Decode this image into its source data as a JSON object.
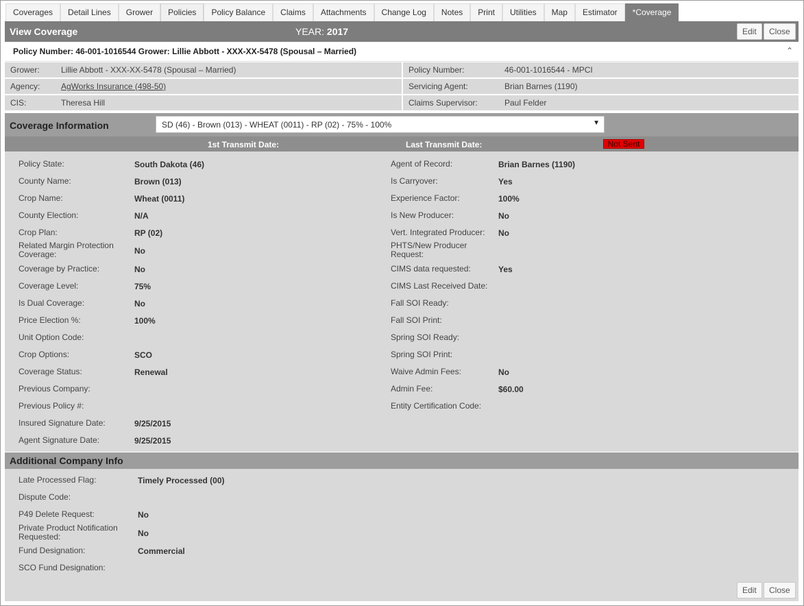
{
  "tabs": [
    {
      "label": "Coverages"
    },
    {
      "label": "Detail Lines"
    },
    {
      "label": "Grower"
    },
    {
      "label": "Policies"
    },
    {
      "label": "Policy Balance"
    },
    {
      "label": "Claims"
    },
    {
      "label": "Attachments"
    },
    {
      "label": "Change Log"
    },
    {
      "label": "Notes"
    },
    {
      "label": "Print"
    },
    {
      "label": "Utilities"
    },
    {
      "label": "Map"
    },
    {
      "label": "Estimator"
    },
    {
      "label": "*Coverage"
    }
  ],
  "header": {
    "title": "View Coverage",
    "year_label": "YEAR:",
    "year_value": "2017",
    "edit_label": "Edit",
    "close_label": "Close"
  },
  "summary": {
    "text": "Policy Number: 46-001-1016544 Grower: Lillie Abbott - XXX-XX-5478 (Spousal – Married)",
    "caret": "^"
  },
  "info": {
    "grower_label": "Grower:",
    "grower_value": "Lillie Abbott - XXX-XX-5478 (Spousal – Married)",
    "policy_number_label": "Policy Number:",
    "policy_number_value": "46-001-1016544 - MPCI",
    "agency_label": "Agency:",
    "agency_value": "AgWorks Insurance (498-50)",
    "servicing_agent_label": "Servicing Agent:",
    "servicing_agent_value": "Brian Barnes (1190)",
    "cis_label": "CIS:",
    "cis_value": "Theresa Hill",
    "claims_supervisor_label": "Claims Supervisor:",
    "claims_supervisor_value": "Paul Felder"
  },
  "coverage_section": {
    "title": "Coverage Information",
    "selected": "SD (46) - Brown (013) - WHEAT (0011) - RP (02) - 75% - 100%",
    "arrow": "▼",
    "first_transmit_label": "1st Transmit Date:",
    "last_transmit_label": "Last Transmit Date:",
    "status_badge": "Not Sent"
  },
  "left_fields": [
    {
      "label": "Policy State:",
      "value": "South Dakota (46)"
    },
    {
      "label": "County Name:",
      "value": "Brown (013)"
    },
    {
      "label": "Crop Name:",
      "value": "Wheat (0011)"
    },
    {
      "label": "County Election:",
      "value": "N/A"
    },
    {
      "label": "Crop Plan:",
      "value": "RP (02)"
    },
    {
      "label": "Related Margin Protection Coverage:",
      "value": "No"
    },
    {
      "label": "Coverage by Practice:",
      "value": "No"
    },
    {
      "label": "Coverage Level:",
      "value": "75%"
    },
    {
      "label": "Is Dual Coverage:",
      "value": "No"
    },
    {
      "label": "Price Election %:",
      "value": "100%"
    },
    {
      "label": "Unit Option Code:",
      "value": ""
    },
    {
      "label": "Crop Options:",
      "value": "SCO"
    },
    {
      "label": "Coverage Status:",
      "value": "Renewal"
    },
    {
      "label": "Previous Company:",
      "value": ""
    },
    {
      "label": "Previous Policy #:",
      "value": ""
    },
    {
      "label": "Insured Signature Date:",
      "value": "9/25/2015"
    },
    {
      "label": "Agent Signature Date:",
      "value": "9/25/2015"
    }
  ],
  "right_fields": [
    {
      "label": "Agent of Record:",
      "value": "Brian Barnes (1190)"
    },
    {
      "label": "Is Carryover:",
      "value": "Yes"
    },
    {
      "label": "Experience Factor:",
      "value": "100%"
    },
    {
      "label": "Is New Producer:",
      "value": "No"
    },
    {
      "label": "Vert. Integrated Producer:",
      "value": "No"
    },
    {
      "label": "PHTS/New Producer Request:",
      "value": ""
    },
    {
      "label": "CIMS data requested:",
      "value": "Yes"
    },
    {
      "label": "CIMS Last Received Date:",
      "value": ""
    },
    {
      "label": "Fall SOI Ready:",
      "value": ""
    },
    {
      "label": "Fall SOI Print:",
      "value": ""
    },
    {
      "label": "Spring SOI Ready:",
      "value": ""
    },
    {
      "label": "Spring SOI Print:",
      "value": ""
    },
    {
      "label": "Waive Admin Fees:",
      "value": "No"
    },
    {
      "label": "Admin Fee:",
      "value": "$60.00"
    },
    {
      "label": "Entity Certification Code:",
      "value": ""
    }
  ],
  "additional_section": {
    "title": "Additional Company Info"
  },
  "additional_fields": [
    {
      "label": "Late Processed Flag:",
      "value": "Timely Processed (00)"
    },
    {
      "label": "Dispute Code:",
      "value": ""
    },
    {
      "label": "P49 Delete Request:",
      "value": "No"
    },
    {
      "label": "Private Product Notification Requested:",
      "value": "No"
    },
    {
      "label": "Fund Designation:",
      "value": "Commercial"
    },
    {
      "label": "SCO Fund Designation:",
      "value": ""
    }
  ],
  "footer": {
    "edit_label": "Edit",
    "close_label": "Close"
  },
  "colors": {
    "header_bg": "#7d7d7d",
    "section_bg": "#9d9d9d",
    "panel_bg": "#d9d9d9",
    "badge_bg": "#e00000"
  }
}
